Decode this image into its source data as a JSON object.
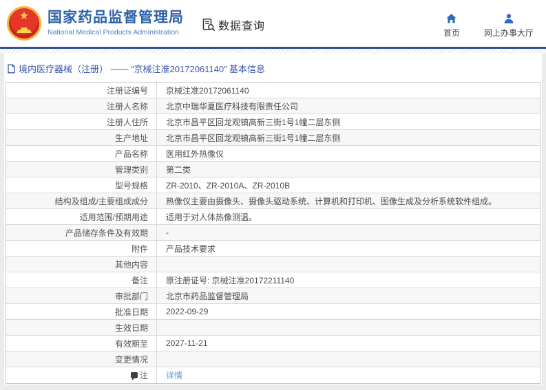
{
  "header": {
    "org_name_zh": "国家药品监督管理局",
    "org_name_en": "National Medical Products Administration",
    "section_title": "数据查询",
    "nav": {
      "home": "首页",
      "service_hall": "网上办事大厅"
    }
  },
  "breadcrumb": {
    "text": "境内医疗器械（注册） —— “京械注准20172061140” 基本信息"
  },
  "table": {
    "rows": [
      {
        "label": "注册证编号",
        "value": "京械注准20172061140"
      },
      {
        "label": "注册人名称",
        "value": "北京中瑞华夏医疗科技有限责任公司"
      },
      {
        "label": "注册人住所",
        "value": "北京市昌平区回龙观镇高新三街1号1幢二层东侧"
      },
      {
        "label": "生产地址",
        "value": "北京市昌平区回龙观镇高新三街1号1幢二层东侧"
      },
      {
        "label": "产品名称",
        "value": "医用红外热像仪"
      },
      {
        "label": "管理类别",
        "value": "第二类"
      },
      {
        "label": "型号规格",
        "value": "ZR-2010、ZR-2010A、ZR-2010B"
      },
      {
        "label": "结构及组成/主要组成成分",
        "value": "热像仪主要由摄像头、摄像头驱动系统、计算机和打印机、图像生成及分析系统软件组成。"
      },
      {
        "label": "适用范围/预期用途",
        "value": "适用于对人体热像测温。"
      },
      {
        "label": "产品储存条件及有效期",
        "value": "-"
      },
      {
        "label": "附件",
        "value": "产品技术要求"
      },
      {
        "label": "其他内容",
        "value": ""
      },
      {
        "label": "备注",
        "value": "原注册证号: 京械注准20172211140"
      },
      {
        "label": "审批部门",
        "value": "北京市药品监督管理局"
      },
      {
        "label": "批准日期",
        "value": "2022-09-29"
      },
      {
        "label": "生效日期",
        "value": ""
      },
      {
        "label": "有效期至",
        "value": "2027-11-21"
      },
      {
        "label": "变更情况",
        "value": ""
      },
      {
        "label": "注",
        "label_icon": "note-bubble-icon",
        "value": "详情",
        "link": true
      }
    ]
  },
  "colors": {
    "brand_blue": "#2a61a8",
    "divider_blue": "#32529f",
    "breadcrumb_blue": "#3a57a7",
    "link_blue": "#5b9bd5",
    "emblem_red": "#d8302a",
    "emblem_gold": "#f2b63c",
    "row_alt_bg": "#f7f7f7",
    "table_border": "#c8c8c8"
  }
}
